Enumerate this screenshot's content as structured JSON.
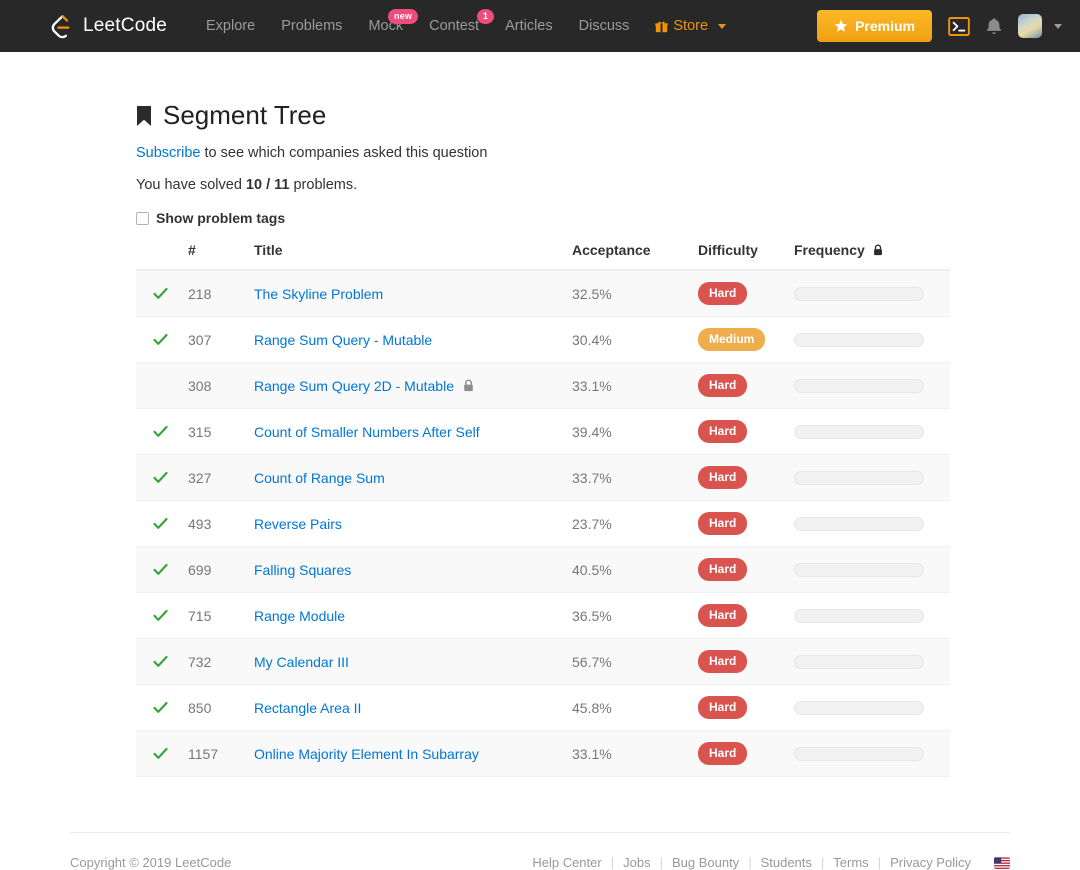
{
  "navbar": {
    "brand": "LeetCode",
    "links": [
      {
        "label": "Explore",
        "badge": null
      },
      {
        "label": "Problems",
        "badge": null
      },
      {
        "label": "Mock",
        "badge": "new"
      },
      {
        "label": "Contest",
        "badge": "1"
      },
      {
        "label": "Articles",
        "badge": null
      },
      {
        "label": "Discuss",
        "badge": null
      }
    ],
    "store_label": "Store",
    "premium_label": "Premium",
    "icons": {
      "console": "console-icon",
      "notifications": "bell-icon",
      "avatar": "avatar"
    },
    "colors": {
      "background": "#282828",
      "accent_orange": "#f0930c",
      "badge_pink": "#ee4c7c",
      "premium_button": "#f0a011"
    }
  },
  "main": {
    "title": "Segment Tree",
    "subscribe_link": "Subscribe",
    "subscribe_rest": " to see which companies asked this question",
    "solved_prefix": "You have solved ",
    "solved_count": "10 / 11",
    "solved_suffix": " problems.",
    "show_tags_label": "Show problem tags",
    "show_tags_checked": false
  },
  "table": {
    "headers": {
      "status": "",
      "id": "#",
      "title": "Title",
      "acceptance": "Acceptance",
      "difficulty": "Difficulty",
      "frequency": "Frequency"
    },
    "rows": [
      {
        "solved": true,
        "id": "218",
        "title": "The Skyline Problem",
        "locked": false,
        "acceptance": "32.5%",
        "difficulty": "Hard",
        "frequency": 0
      },
      {
        "solved": true,
        "id": "307",
        "title": "Range Sum Query - Mutable",
        "locked": false,
        "acceptance": "30.4%",
        "difficulty": "Medium",
        "frequency": 0
      },
      {
        "solved": false,
        "id": "308",
        "title": "Range Sum Query 2D - Mutable",
        "locked": true,
        "acceptance": "33.1%",
        "difficulty": "Hard",
        "frequency": 0
      },
      {
        "solved": true,
        "id": "315",
        "title": "Count of Smaller Numbers After Self",
        "locked": false,
        "acceptance": "39.4%",
        "difficulty": "Hard",
        "frequency": 0
      },
      {
        "solved": true,
        "id": "327",
        "title": "Count of Range Sum",
        "locked": false,
        "acceptance": "33.7%",
        "difficulty": "Hard",
        "frequency": 0
      },
      {
        "solved": true,
        "id": "493",
        "title": "Reverse Pairs",
        "locked": false,
        "acceptance": "23.7%",
        "difficulty": "Hard",
        "frequency": 0
      },
      {
        "solved": true,
        "id": "699",
        "title": "Falling Squares",
        "locked": false,
        "acceptance": "40.5%",
        "difficulty": "Hard",
        "frequency": 0
      },
      {
        "solved": true,
        "id": "715",
        "title": "Range Module",
        "locked": false,
        "acceptance": "36.5%",
        "difficulty": "Hard",
        "frequency": 0
      },
      {
        "solved": true,
        "id": "732",
        "title": "My Calendar III",
        "locked": false,
        "acceptance": "56.7%",
        "difficulty": "Hard",
        "frequency": 0
      },
      {
        "solved": true,
        "id": "850",
        "title": "Rectangle Area II",
        "locked": false,
        "acceptance": "45.8%",
        "difficulty": "Hard",
        "frequency": 0
      },
      {
        "solved": true,
        "id": "1157",
        "title": "Online Majority Element In Subarray",
        "locked": false,
        "acceptance": "33.1%",
        "difficulty": "Hard",
        "frequency": 0
      }
    ]
  },
  "footer": {
    "copyright": "Copyright © 2019 LeetCode",
    "links": [
      "Help Center",
      "Jobs",
      "Bug Bounty",
      "Students",
      "Terms",
      "Privacy Policy"
    ],
    "separator": "|",
    "flag": "us-flag-icon"
  }
}
